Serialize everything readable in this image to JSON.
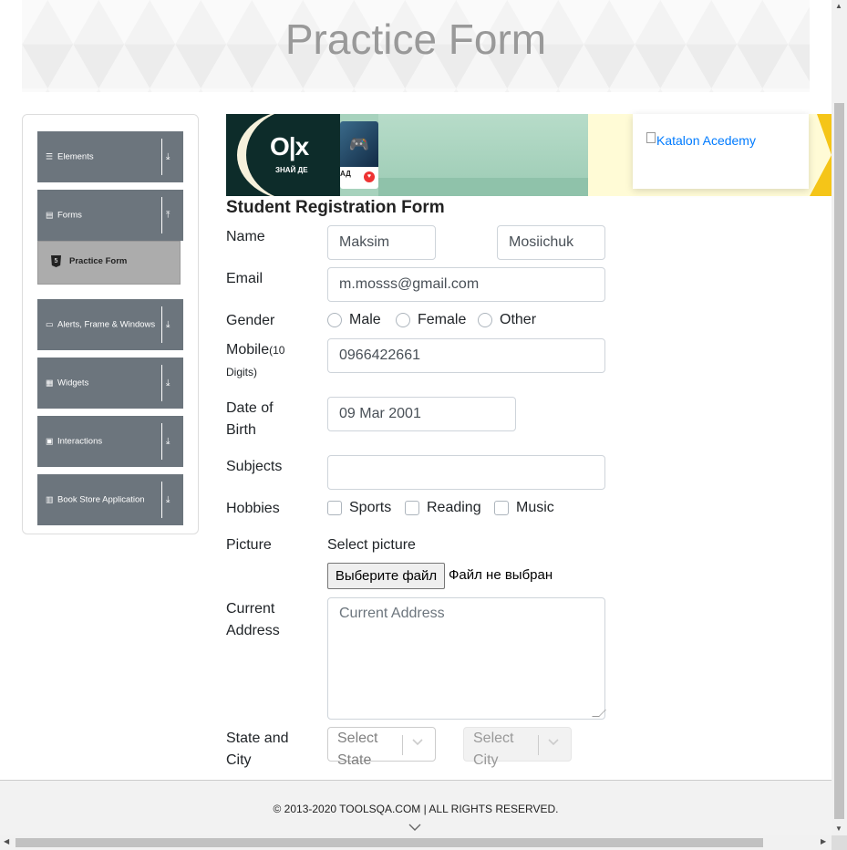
{
  "header": {
    "title": "Practice Form"
  },
  "sidebar": {
    "groups": [
      {
        "label": "Elements",
        "icon": "hamburger-icon",
        "arrow": "expand-down-icon"
      },
      {
        "label": "Forms",
        "icon": "file-icon",
        "arrow": "collapse-up-icon"
      },
      {
        "label": "Alerts, Frame & Windows",
        "icon": "window-icon",
        "arrow": "expand-down-icon"
      },
      {
        "label": "Widgets",
        "icon": "grid-icon",
        "arrow": "expand-down-icon"
      },
      {
        "label": "Interactions",
        "icon": "square-icon",
        "arrow": "expand-down-icon"
      },
      {
        "label": "Book Store Application",
        "icon": "books-icon",
        "arrow": "expand-down-icon"
      }
    ],
    "active_item": {
      "label": "Practice Form",
      "icon": "html5-icon"
    }
  },
  "ad": {
    "brand": "O|x",
    "tagline": "ЗНАЙ ДЕ",
    "card_caption": "АД",
    "katalon_alt": "Katalon Acedemy"
  },
  "form": {
    "title": "Student Registration Form",
    "name": {
      "label": "Name",
      "first": "Maksim",
      "last": "Mosiichuk"
    },
    "email": {
      "label": "Email",
      "value": "m.mosss@gmail.com"
    },
    "gender": {
      "label": "Gender",
      "options": [
        "Male",
        "Female",
        "Other"
      ]
    },
    "mobile": {
      "label": "Mobile",
      "hint": "(10 Digits)",
      "value": "0966422661"
    },
    "dob": {
      "label": "Date of Birth",
      "value": "09 Mar 2001"
    },
    "subjects": {
      "label": "Subjects",
      "value": ""
    },
    "hobbies": {
      "label": "Hobbies",
      "options": [
        "Sports",
        "Reading",
        "Music"
      ]
    },
    "picture": {
      "label": "Picture",
      "helper": "Select picture",
      "button": "Выберите файл",
      "status": "Файл не выбран"
    },
    "address": {
      "label": "Current Address",
      "placeholder": "Current Address"
    },
    "state_city": {
      "label": "State and City",
      "state_placeholder": "Select State",
      "city_placeholder": "Select City"
    }
  },
  "footer": {
    "text": "© 2013-2020 TOOLSQA.COM | ALL RIGHTS RESERVED."
  }
}
